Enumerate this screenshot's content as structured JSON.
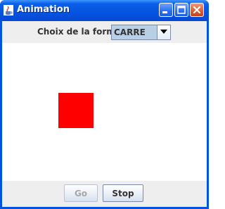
{
  "window": {
    "title": "Animation",
    "icon": "java-cup-icon",
    "controls": [
      "minimize-icon",
      "maximize-icon",
      "close-icon"
    ]
  },
  "top_panel": {
    "label": "Choix de la forme",
    "combo": {
      "selected": "CARRE",
      "icon": "chevron-down-icon"
    }
  },
  "canvas": {
    "shape": "square",
    "shape_color": "#ff0000",
    "background": "#ffffff"
  },
  "buttons": {
    "go_label": "Go",
    "go_enabled": false,
    "stop_label": "Stop",
    "stop_enabled": true
  },
  "colors": {
    "titlebar": "#0654e2",
    "panel": "#eeeeee",
    "combo_bg": "#b8cfe5"
  }
}
